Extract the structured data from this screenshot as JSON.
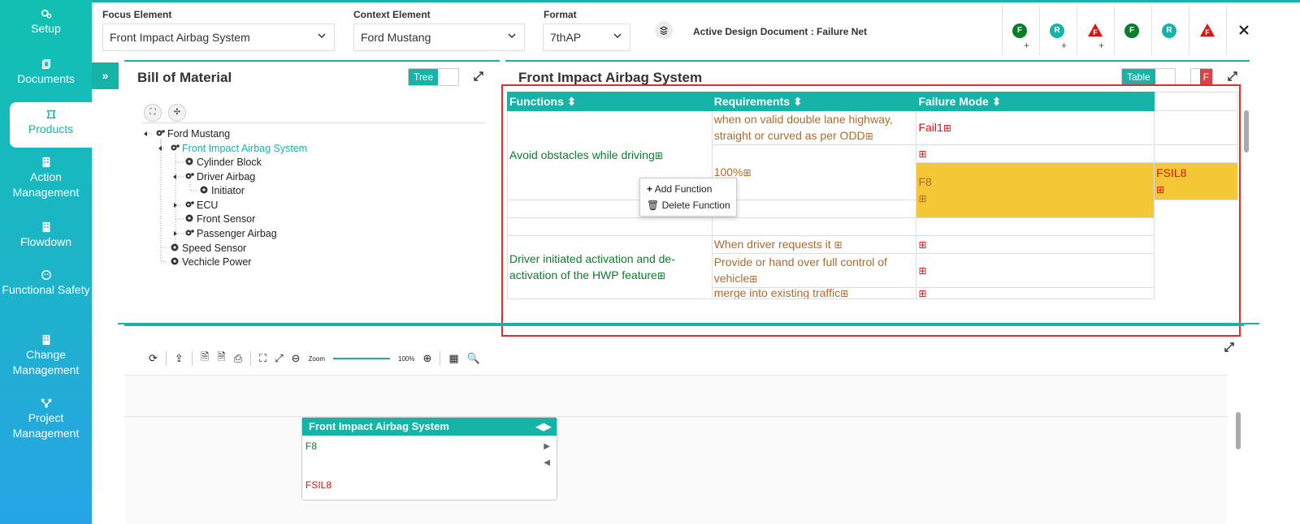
{
  "sidebar": {
    "items": [
      {
        "label": "Setup",
        "icon": "gears-icon"
      },
      {
        "label": "Documents",
        "icon": "documents-icon"
      },
      {
        "label": "Products",
        "icon": "products-icon"
      },
      {
        "label": "Action Management",
        "icon": "building-icon"
      },
      {
        "label": "Flowdown",
        "icon": "building-icon"
      },
      {
        "label": "Functional Safety",
        "icon": "safety-icon"
      },
      {
        "label": "Change Management",
        "icon": "building-icon"
      },
      {
        "label": "Project Management",
        "icon": "network-icon"
      }
    ]
  },
  "topbar": {
    "focus_label": "Focus Element",
    "focus_value": "Front Impact Airbag System",
    "context_label": "Context Element",
    "context_value": "Ford Mustang",
    "format_label": "Format",
    "format_value": "7thAP",
    "active_doc": "Active Design Document : Failure Net",
    "badges": [
      "F",
      "R",
      "F",
      "F",
      "R",
      "F"
    ]
  },
  "bom": {
    "title": "Bill of Material",
    "toggle_label": "Tree",
    "tree": [
      {
        "label": "Ford Mustang",
        "type": "assembly"
      },
      {
        "label": "Front Impact Airbag System",
        "type": "assembly"
      },
      {
        "label": "Cylinder Block",
        "type": "part"
      },
      {
        "label": "Driver Airbag",
        "type": "assembly"
      },
      {
        "label": "Initiator",
        "type": "part"
      },
      {
        "label": "ECU",
        "type": "assembly"
      },
      {
        "label": "Front Sensor",
        "type": "part"
      },
      {
        "label": "Passenger Airbag",
        "type": "assembly"
      },
      {
        "label": "Speed Sensor",
        "type": "part"
      },
      {
        "label": "Vechicle Power",
        "type": "part"
      }
    ]
  },
  "table_panel": {
    "title": "Front Impact Airbag System",
    "toggle_label": "Table",
    "f_label": "F",
    "headers": [
      "Functions",
      "Requirements",
      "Failure Mode"
    ],
    "rows": {
      "func1": "Avoid obstacles while driving",
      "req1": "when on valid double lane highway, straight or curved as per ODD",
      "fail1": "Fail1",
      "req2": "100%",
      "fm_f8": "F8",
      "fsil8": "FSIL8",
      "func2": "Driver initiated activation and de-activation of the HWP feature",
      "req3": "When driver requests it",
      "req4": "Provide or hand over full control of vehicle",
      "req5": "merge into existing traffic"
    }
  },
  "context_menu": {
    "add": "Add Function",
    "delete": "Delete Function"
  },
  "diagram": {
    "zoom_label": "Zoom",
    "zoom_value": "100%",
    "node_title": "Front Impact Airbag System",
    "node_fm": "F8",
    "node_fsil": "FSIL8"
  },
  "colors": {
    "accent": "#18b3a7",
    "highlight": "#f4c737",
    "function_green": "#0a7d2b",
    "requirement_brown": "#b06a2a",
    "failure_red": "#e01010"
  }
}
